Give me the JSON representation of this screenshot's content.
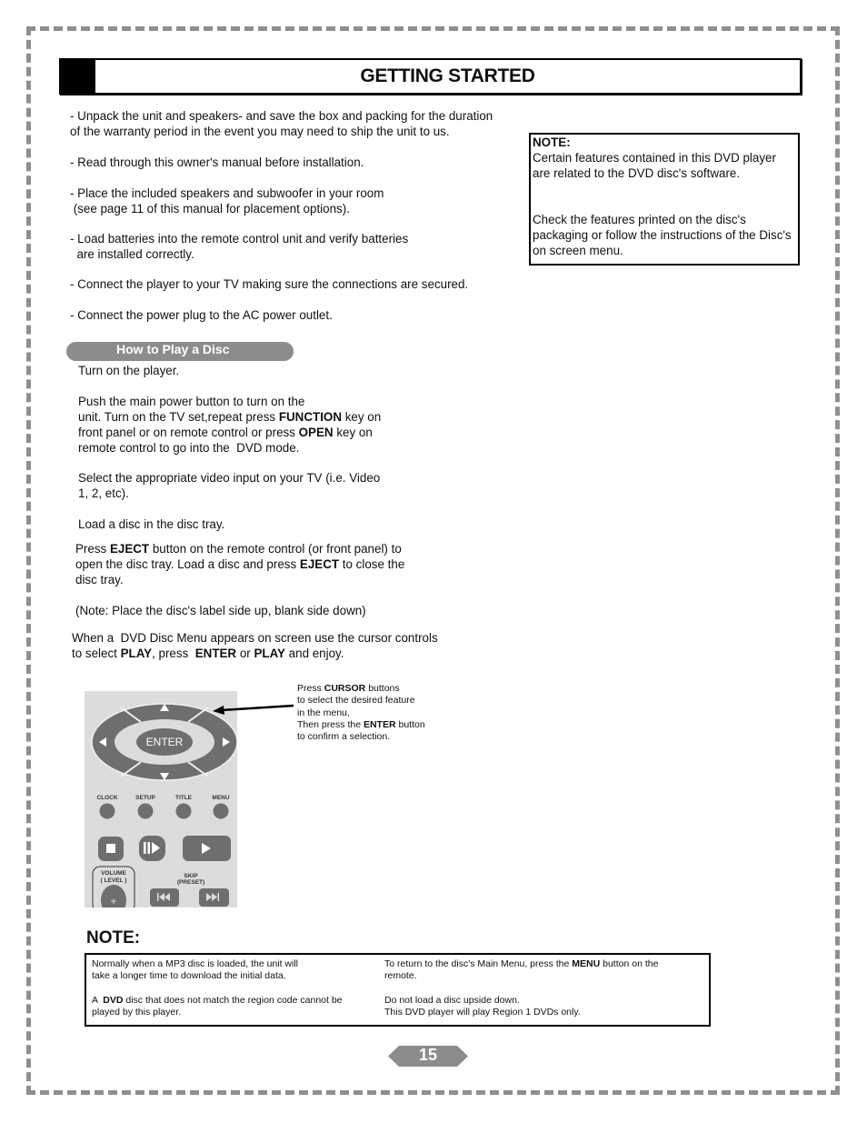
{
  "header": {
    "title": "GETTING STARTED"
  },
  "steps": [
    {
      "line1": "- Unpack the unit and speakers- and save the box and packing for the duration",
      "line2": "of the warranty period in the event you may need to ship the unit to us."
    },
    {
      "line1": "- Read through this owner's manual before installation."
    },
    {
      "line1": "- Place the included speakers and subwoofer in your room",
      "line2": " (see page 11 of this manual for placement options)."
    },
    {
      "line1": "- Load batteries into the remote control unit and verify batteries",
      "line2": "  are installed correctly."
    },
    {
      "line1": "- Connect the player to your TV making sure the connections are secured."
    },
    {
      "line1": "- Connect the power plug to the AC power outlet."
    }
  ],
  "side_note": {
    "heading": "NOTE:",
    "para1": "Certain features contained in this DVD player are related to the DVD disc's software.",
    "para2": "Check the features printed on the disc's packaging or follow the instructions of the Disc's on screen menu."
  },
  "how_to": {
    "title": "How to Play a Disc",
    "turn_on": "Turn on the player.",
    "push": {
      "l1": "Push the main power button to turn on the",
      "l2a": "unit. Turn on the TV set,repeat press ",
      "l2b": "FUNCTION",
      "l2c": " key on",
      "l3a": "front panel or on remote control or press ",
      "l3b": "OPEN",
      "l3c": " key on",
      "l4": "remote control to go into the  DVD mode."
    },
    "select": {
      "l1": "Select the appropriate video input on your TV (i.e. Video",
      "l2": "1, 2, etc)."
    },
    "load": "Load a disc in the disc tray.",
    "eject": {
      "l1a": "Press ",
      "l1b": "EJECT",
      "l1c": " button on the remote control (or front panel) to",
      "l2a": "open the disc tray. Load a disc and press ",
      "l2b": "EJECT",
      "l2c": " to close the",
      "l3": "disc tray."
    },
    "label_note": "(Note: Place the disc's label side up, blank side down)",
    "menu": {
      "l1": "When a  DVD Disc Menu appears on screen use the cursor controls",
      "l2a": "to select ",
      "l2b": "PLAY",
      "l2c": ", press  ",
      "l2d": "ENTER",
      "l2e": " or ",
      "l2f": "PLAY",
      "l2g": " and enjoy."
    }
  },
  "remote": {
    "enter": "ENTER",
    "buttons": [
      "CLOCK",
      "SETUP",
      "TITLE",
      "MENU"
    ],
    "volume": "VOLUME",
    "level": "( LEVEL )",
    "skip": "SKIP",
    "preset": "(PRESET)"
  },
  "callout": {
    "l1a": "Press ",
    "l1b": "CURSOR",
    "l1c": " buttons",
    "l2": "to select the desired feature",
    "l3": "in the menu,",
    "l4a": "Then press the ",
    "l4b": "ENTER",
    "l4c": " button",
    "l5": "to confirm a selection."
  },
  "bottom_note": {
    "heading": "NOTE:",
    "left": {
      "l1": "Normally when a MP3 disc is loaded, the unit will",
      "l2": "take a longer time to download the initial data.",
      "l3a": "A  ",
      "l3b": "DVD",
      "l3c": " disc that does not match the region code cannot be",
      "l4": "played by this player."
    },
    "right": {
      "l1a": "To return to the disc's Main Menu, press the ",
      "l1b": "MENU",
      "l1c": " button on the",
      "l2": "remote.",
      "l3": "Do not load a disc upside down.",
      "l4": "This DVD player will play Region 1 DVDs only."
    }
  },
  "page_number": "15",
  "colors": {
    "frame": "#8f8f8f",
    "pill": "#8c8c8c",
    "remote_bg": "#dcdcdc",
    "remote_button": "#6e6e6e"
  }
}
